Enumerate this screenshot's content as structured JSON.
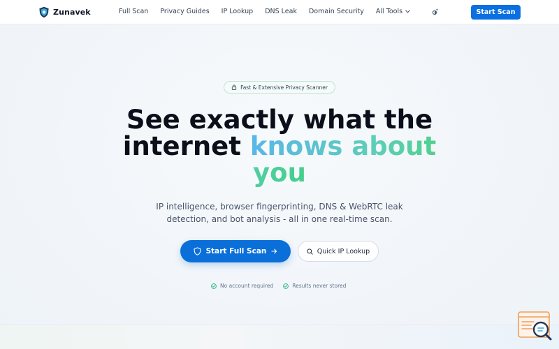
{
  "brand": {
    "name": "Zunavek",
    "logo_icon": "shield-logo-icon"
  },
  "nav": {
    "items": [
      {
        "label": "Full Scan"
      },
      {
        "label": "Privacy Guides"
      },
      {
        "label": "IP Lookup"
      },
      {
        "label": "DNS Leak"
      },
      {
        "label": "Domain Security"
      },
      {
        "label": "All Tools",
        "icon": "chevron-down-icon"
      }
    ],
    "theme_icon": "theme-toggle-icon",
    "cta_label": "Start Scan"
  },
  "hero": {
    "badge_icon": "lock-icon",
    "badge_text": "Fast & Extensive Privacy Scanner",
    "headline_part1": "See exactly what the",
    "headline_part2": "internet",
    "headline_highlight1": "knows about",
    "headline_highlight2": "you",
    "subtitle": "IP intelligence, browser fingerprinting, DNS & WebRTC leak detection, and bot analysis - all in one real-time scan.",
    "primary_cta": "Start Full Scan",
    "primary_cta_icon": "shield-icon",
    "primary_cta_arrow": "arrow-right-icon",
    "secondary_cta": "Quick IP Lookup",
    "secondary_cta_icon": "search-icon",
    "reassurance": [
      {
        "icon": "check-circle-icon",
        "label": "No account required"
      },
      {
        "icon": "check-circle-icon",
        "label": "Results never stored"
      }
    ]
  },
  "colors": {
    "primary": "#0a6fd8",
    "gradient_start": "#5ab6e8",
    "gradient_end": "#4fd08f",
    "check": "#22b07d"
  }
}
